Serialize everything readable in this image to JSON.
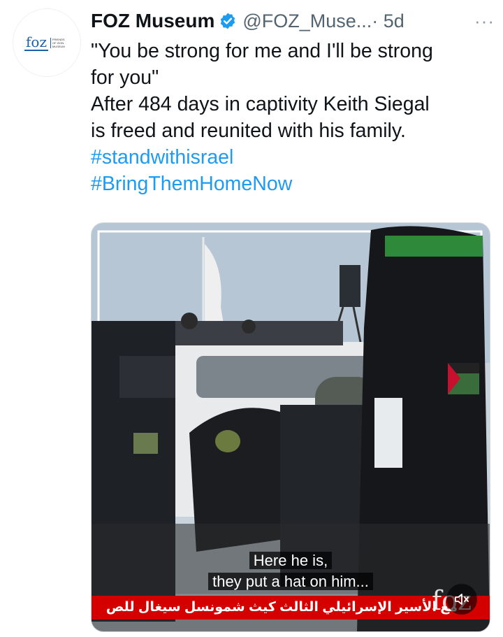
{
  "tweet": {
    "author_name": "FOZ Museum",
    "author_handle": "@FOZ_Muse...",
    "time": "· 5d",
    "more_icon": "more-icon",
    "lines": [
      "\"You be strong for me and I'll be strong",
      "for you\"",
      "After 484 days in captivity Keith Siegal",
      "is freed and reunited with his family."
    ],
    "hashtags": [
      "#standwithisrael",
      "#BringThemHomeNow"
    ],
    "accent_color": "#1d9bf0",
    "verified_color": "#1d9bf0"
  },
  "avatar": {
    "logo_text": "foz",
    "logo_subtext": "FRIENDS OF ZION MUSEUM"
  },
  "video": {
    "subtitle_lines": [
      "Here he is,",
      "they put a hat on him..."
    ],
    "arabic_caption": "مع الأسير الإسرائيلي الثالث كيث شمونسل سيغال للص",
    "watermark_text": "foz",
    "mute_icon": "speaker-muted-icon",
    "caption_band_color": "#d40000"
  }
}
